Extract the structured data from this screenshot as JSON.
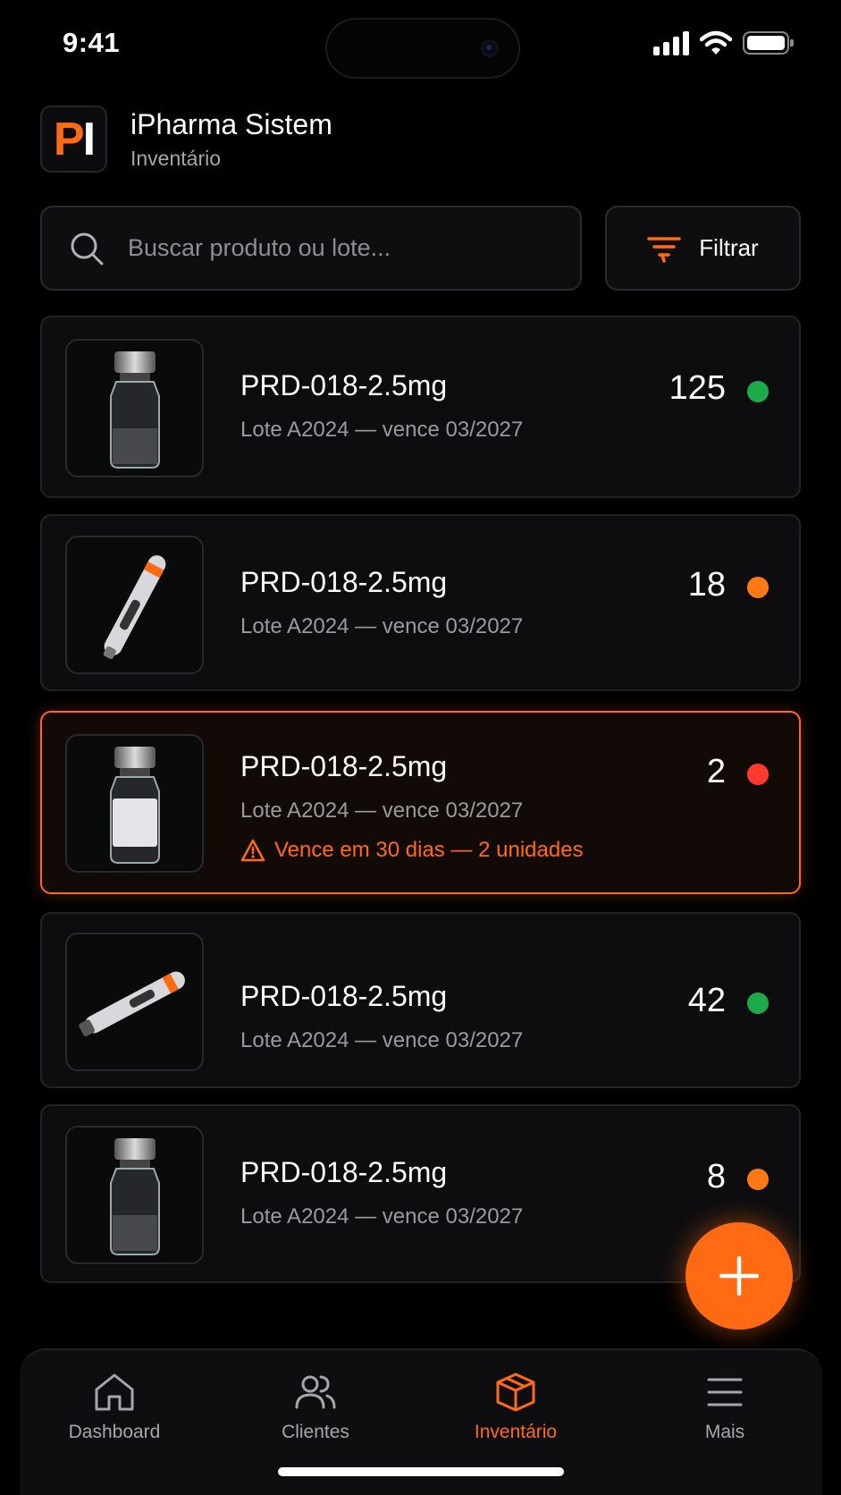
{
  "status_bar": {
    "time": "9:41"
  },
  "header": {
    "logo_p": "P",
    "logo_i": "I",
    "title": "iPharma Sistem",
    "subtitle": "Inventário"
  },
  "search": {
    "placeholder": "Buscar produto ou lote...",
    "value": ""
  },
  "filter": {
    "label": "Filtrar"
  },
  "products": [
    {
      "name": "PRD-018-2.5mg",
      "lot": "Lote A2024 — vence 03/2027",
      "qty": "125",
      "status": "green",
      "image": "vial-clear-icon"
    },
    {
      "name": "PRD-018-2.5mg",
      "lot": "Lote A2024 — vence 03/2027",
      "qty": "18",
      "status": "orange",
      "image": "pen-injector-icon"
    },
    {
      "name": "PRD-018-2.5mg",
      "lot": "Lote A2024 — vence 03/2027",
      "qty": "2",
      "status": "red",
      "image": "vial-labeled-icon",
      "alert": "Vence em 30 dias — 2 unidades"
    },
    {
      "name": "PRD-018-2.5mg",
      "lot": "Lote A2024 — vence 03/2027",
      "qty": "42",
      "status": "green",
      "image": "pen-injector-icon"
    },
    {
      "name": "PRD-018-2.5mg",
      "lot": "Lote A2024 — vence 03/2027",
      "qty": "8",
      "status": "orange",
      "image": "vial-clear-icon"
    }
  ],
  "nav": [
    {
      "label": "Dashboard",
      "icon": "home-icon"
    },
    {
      "label": "Clientes",
      "icon": "users-icon"
    },
    {
      "label": "Inventário",
      "icon": "box-icon",
      "active": true
    },
    {
      "label": "Mais",
      "icon": "menu-icon"
    }
  ],
  "colors": {
    "accent": "#ff6a13",
    "ok": "#1faa4a",
    "warn": "#ff7a12",
    "danger": "#ff3b2f",
    "background": "#000000"
  }
}
